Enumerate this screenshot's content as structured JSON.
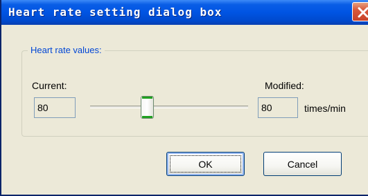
{
  "window": {
    "title": "Heart rate setting dialog box",
    "close_icon": "close-icon"
  },
  "group": {
    "label": "Heart rate values:"
  },
  "current": {
    "label": "Current:",
    "value": "80"
  },
  "modified": {
    "label": "Modified:",
    "value": "80",
    "unit": "times/min"
  },
  "slider": {
    "position_fraction": 0.35
  },
  "buttons": {
    "ok_label": "OK",
    "cancel_label": "Cancel"
  },
  "colors": {
    "titlebar": "#0054e3",
    "group_label": "#0046d5",
    "dialog_background": "#ece9d8",
    "close_button": "#d9583a",
    "slider_thumb_accent": "#21a121"
  }
}
